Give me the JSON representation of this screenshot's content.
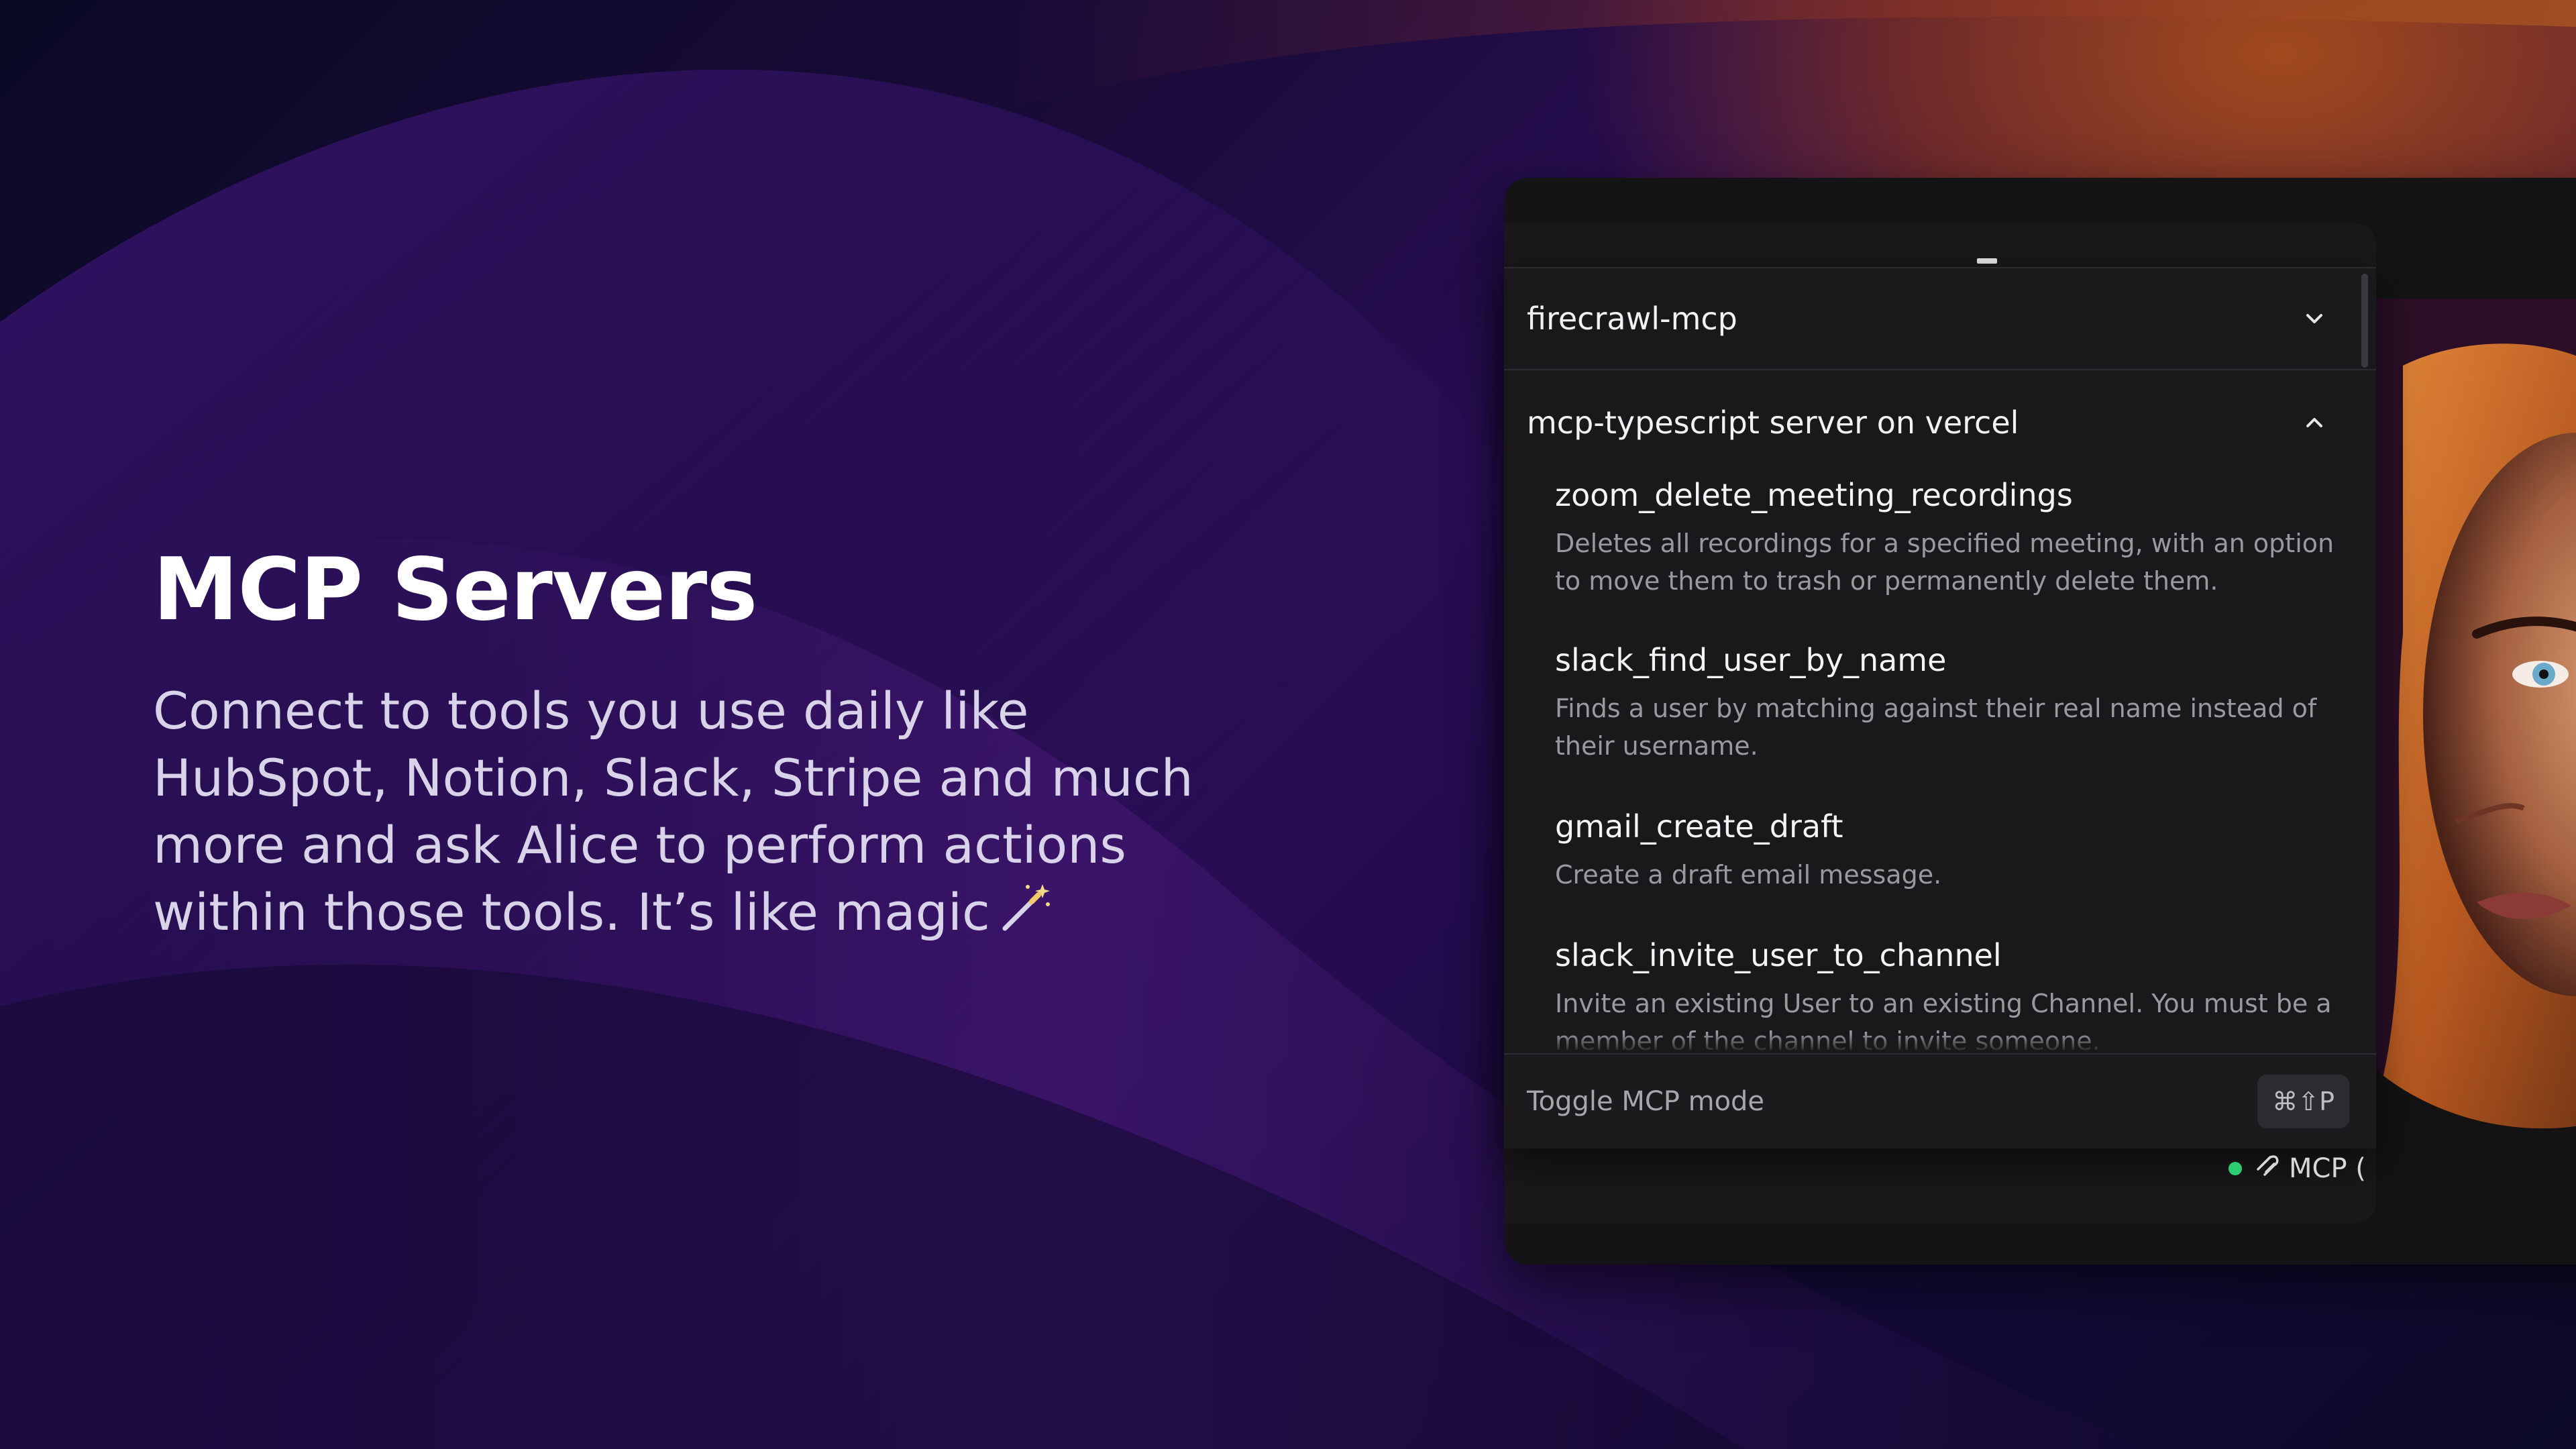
{
  "hero": {
    "title": "MCP Servers",
    "description": "Connect to tools you use daily like HubSpot, Notion, Slack, Stripe and much more and ask Alice to perform actions within those tools. It’s like magic",
    "trailing_icon": "magic-wand-icon"
  },
  "mcp_panel": {
    "groups": [
      {
        "label": "firecrawl-mcp",
        "expanded": false,
        "icon": "chevron-down-icon"
      },
      {
        "label": "mcp-typescript server on vercel",
        "expanded": true,
        "icon": "chevron-up-icon"
      }
    ],
    "tools": [
      {
        "name": "zoom_delete_meeting_recordings",
        "description": "Deletes all recordings for a specified meeting, with an option to move them to trash or permanently delete them."
      },
      {
        "name": "slack_find_user_by_name",
        "description": "Finds a user by matching against their real name instead of their username."
      },
      {
        "name": "gmail_create_draft",
        "description": "Create a draft email message."
      },
      {
        "name": "slack_invite_user_to_channel",
        "description": "Invite an existing User to an existing Channel. You must be a member of the channel to invite someone."
      }
    ],
    "footer": {
      "label": "Toggle MCP mode",
      "shortcut": "⌘⇧P"
    }
  },
  "status": {
    "label": "MCP (",
    "dot_color": "#2ecc71",
    "icon": "mcp-plug-icon"
  },
  "colors": {
    "panel_bg": "#19191b",
    "text_primary": "#f4f4f4",
    "text_secondary": "#9a9a9e"
  }
}
